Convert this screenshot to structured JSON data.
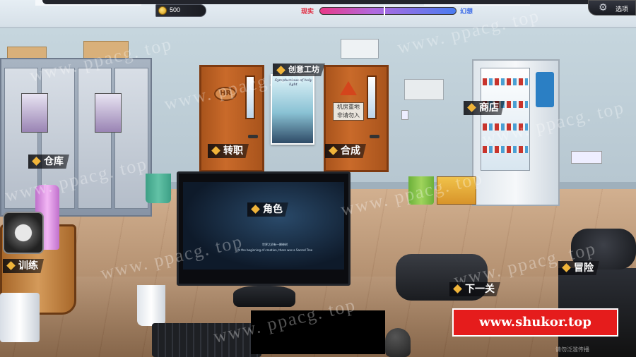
{
  "hud": {
    "coins": "500",
    "real_label": "现实",
    "fantasy_label": "幻想",
    "options_label": "选项",
    "balance_level": 0.47
  },
  "poster": {
    "tag": "创意工坊",
    "title": "Symphonious of holy light"
  },
  "door_hr": {
    "plate": "HR"
  },
  "door_synth": {
    "sign": "机房重地 非请勿入"
  },
  "locations": {
    "warehouse": "仓库",
    "change_job": "转职",
    "synthesize": "合成",
    "shop": "商店",
    "character": "角色",
    "training": "训练",
    "next_level": "下一关",
    "adventure": "冒险"
  },
  "monitor": {
    "line1": "世界之初有一棵神树",
    "line2": "At the beginning of creation, there was a Sacred Tree"
  },
  "watermark": "www. ppacg. top",
  "brand": "www.shukor.top",
  "footer": "请勿泛滥传播"
}
